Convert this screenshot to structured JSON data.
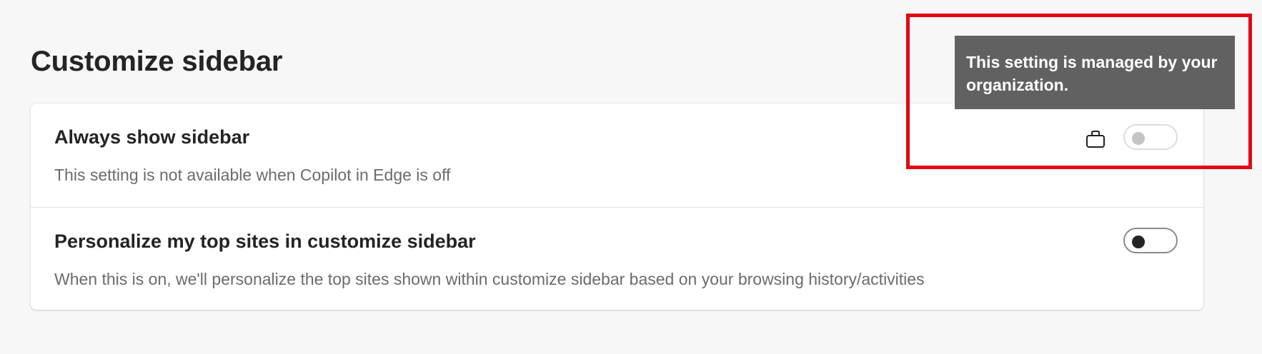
{
  "page": {
    "title": "Customize sidebar"
  },
  "settings": [
    {
      "title": "Always show sidebar",
      "description": "This setting is not available when Copilot in Edge is off",
      "toggle_state": "off",
      "disabled": true,
      "managed_icon": "briefcase-icon"
    },
    {
      "title": "Personalize my top sites in customize sidebar",
      "description": "When this is on, we'll personalize the top sites shown within customize sidebar based on your browsing history/activities",
      "toggle_state": "off",
      "disabled": false
    }
  ],
  "tooltip": {
    "text": "This setting is managed by your organization."
  },
  "annotation": {
    "highlight_color": "#e30613"
  },
  "colors": {
    "background": "#f7f7f7",
    "card": "#ffffff",
    "tooltip_bg": "#616161"
  }
}
